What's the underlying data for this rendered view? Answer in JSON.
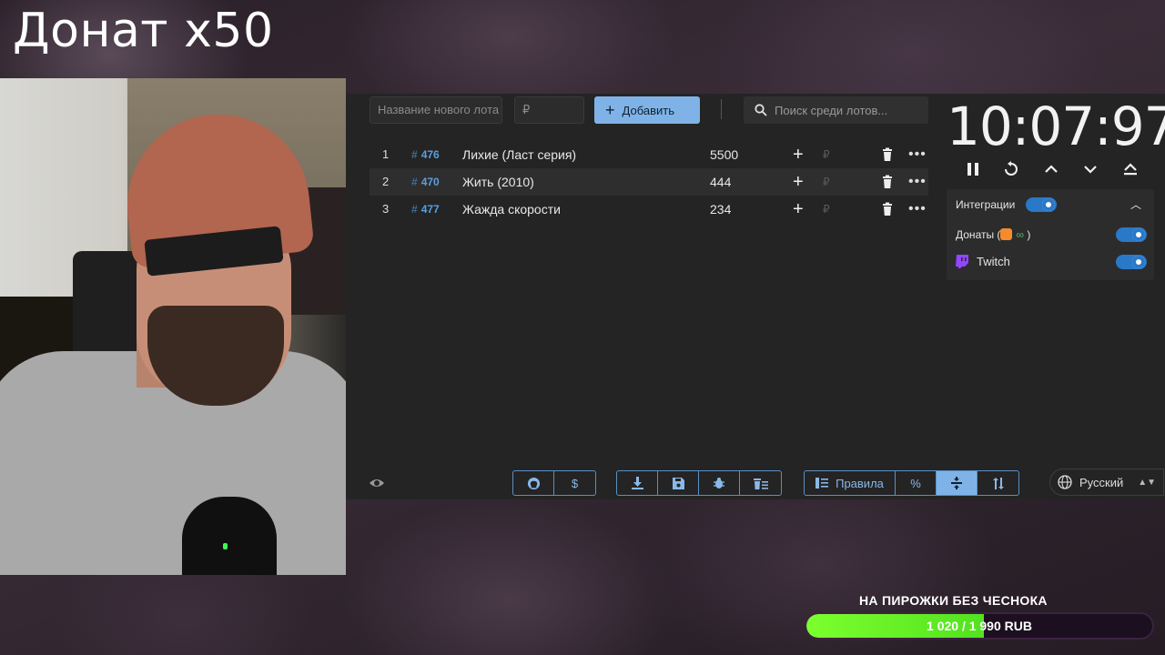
{
  "overlay": {
    "title": "Донат x50"
  },
  "form": {
    "name_placeholder": "Название нового лота",
    "amount_placeholder": "₽",
    "add_label": "Добавить",
    "search_placeholder": "Поиск среди лотов..."
  },
  "lots": [
    {
      "num": "1",
      "id": "476",
      "name": "Лихие (Ласт серия)",
      "amount": "5500"
    },
    {
      "num": "2",
      "id": "470",
      "name": "Жить (2010)",
      "amount": "444"
    },
    {
      "num": "3",
      "id": "477",
      "name": "Жажда скорости",
      "amount": "234"
    }
  ],
  "row_currency": "₽",
  "timer": {
    "value": "10:07:97"
  },
  "integrations": {
    "title": "Интеграции",
    "donations": "Донаты (",
    "donations_close": ")",
    "twitch": "Twitch",
    "enabled": true,
    "donations_enabled": true,
    "twitch_enabled": true
  },
  "toolbar": {
    "rules_label": "Правила",
    "percent_label": "%",
    "dollar_label": "$",
    "language": "Русский"
  },
  "goal": {
    "title": "НА ПИРОЖКИ БЕЗ ЧЕСНОКА",
    "progress_text": "1 020 / 1 990 RUB",
    "fraction": 0.513
  },
  "colors": {
    "accent": "#7fb3e8",
    "goal_fill": "#6cf326",
    "toggle": "#2a78c8"
  }
}
